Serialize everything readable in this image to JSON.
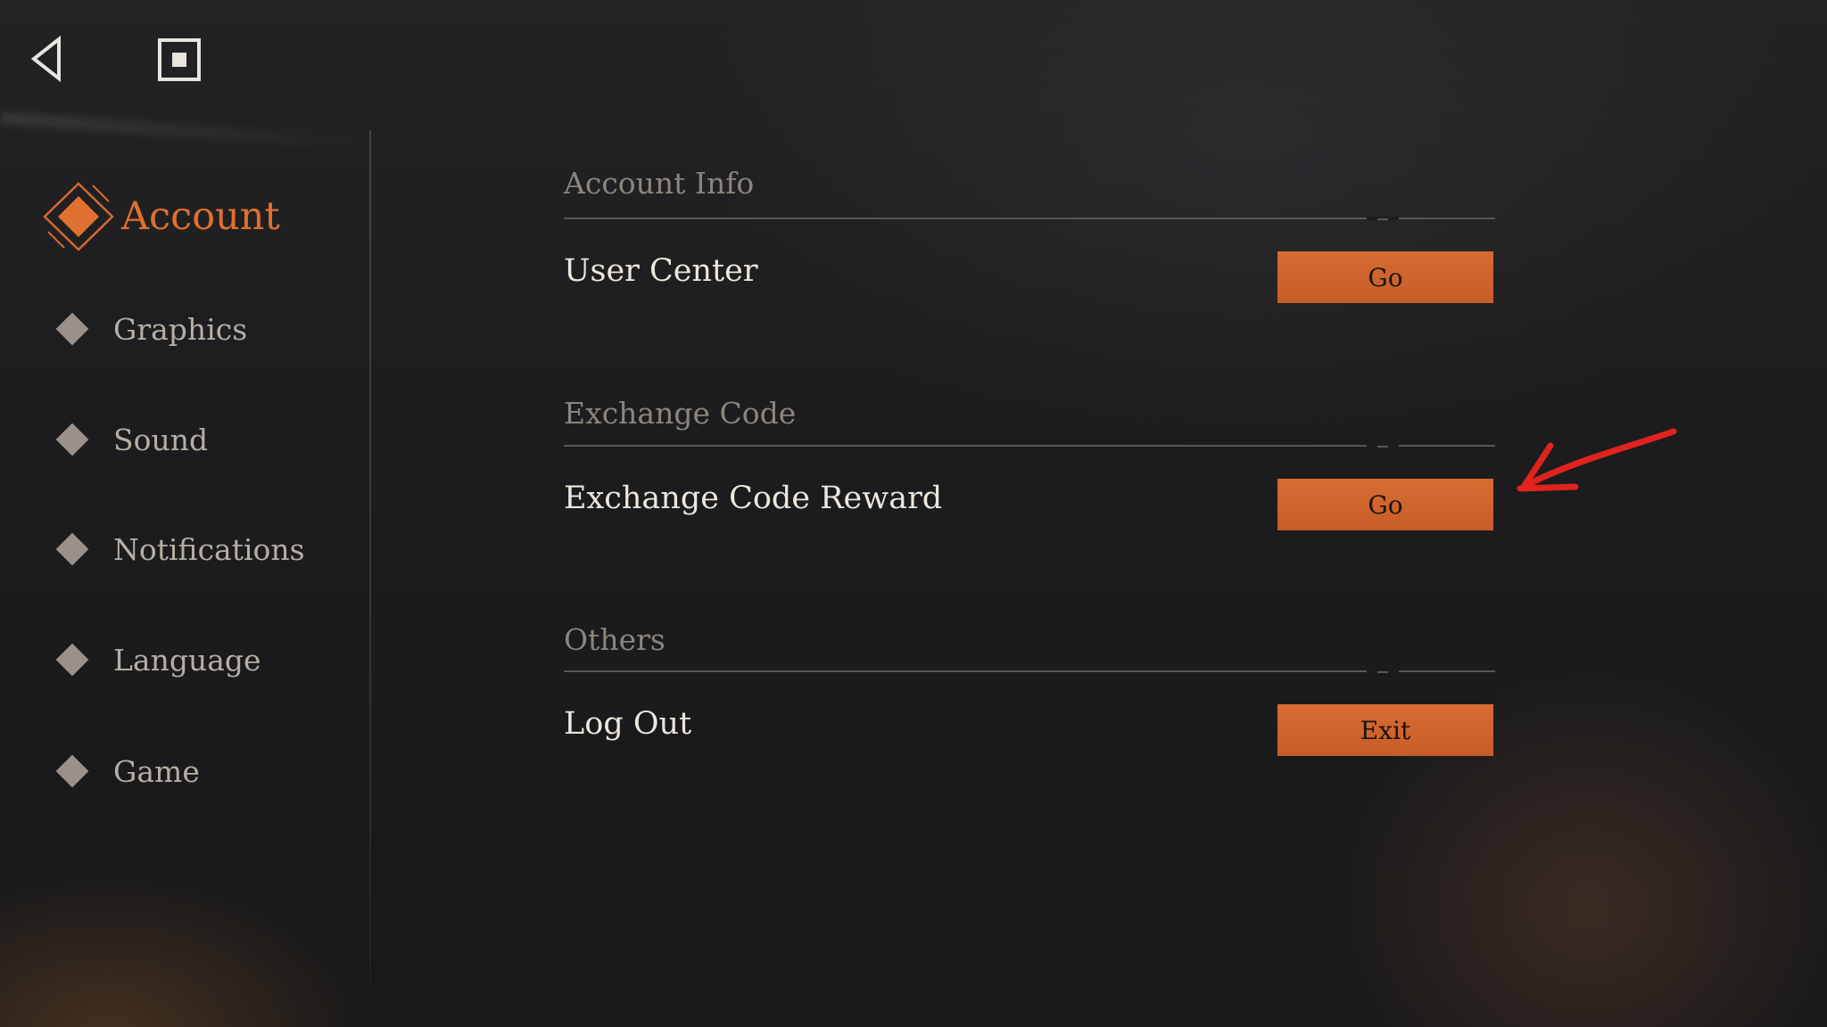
{
  "sidebar": {
    "active": {
      "label": "Account",
      "icon": "account-diamond-icon"
    },
    "items": [
      {
        "label": "Graphics",
        "icon": "diamond-icon"
      },
      {
        "label": "Sound",
        "icon": "diamond-icon"
      },
      {
        "label": "Notifications",
        "icon": "diamond-icon"
      },
      {
        "label": "Language",
        "icon": "diamond-icon"
      },
      {
        "label": "Game",
        "icon": "diamond-icon"
      }
    ]
  },
  "toolbar": {
    "back_icon": "back-triangle-icon",
    "home_icon": "square-stop-icon"
  },
  "sections": [
    {
      "title": "Account Info",
      "row_label": "User Center",
      "button_label": "Go"
    },
    {
      "title": "Exchange Code",
      "row_label": "Exchange Code Reward",
      "button_label": "Go"
    },
    {
      "title": "Others",
      "row_label": "Log Out",
      "button_label": "Exit"
    }
  ],
  "colors": {
    "accent": "#D4692F",
    "button": "#CF632D",
    "annotation": "#E0231E",
    "background": "#1C1C1E"
  }
}
